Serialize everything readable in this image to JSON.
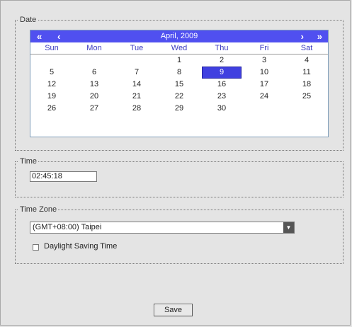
{
  "date_group": {
    "legend": "Date",
    "calendar": {
      "title": "April, 2009",
      "nav": {
        "prev_year": "«",
        "prev_month": "‹",
        "next_month": "›",
        "next_year": "»"
      },
      "weekdays": [
        "Sun",
        "Mon",
        "Tue",
        "Wed",
        "Thu",
        "Fri",
        "Sat"
      ],
      "weeks": [
        [
          "",
          "",
          "",
          "1",
          "2",
          "3",
          "4"
        ],
        [
          "5",
          "6",
          "7",
          "8",
          "9",
          "10",
          "11"
        ],
        [
          "12",
          "13",
          "14",
          "15",
          "16",
          "17",
          "18"
        ],
        [
          "19",
          "20",
          "21",
          "22",
          "23",
          "24",
          "25"
        ],
        [
          "26",
          "27",
          "28",
          "29",
          "30",
          "",
          ""
        ]
      ],
      "selected_day": "9"
    }
  },
  "time_group": {
    "legend": "Time",
    "value": "02:45:18"
  },
  "timezone_group": {
    "legend": "Time Zone",
    "selected": "(GMT+08:00) Taipei",
    "daylight_label": "Daylight Saving Time",
    "daylight_checked": false
  },
  "actions": {
    "save_label": "Save"
  },
  "colors": {
    "calendar_header": "#5050f0",
    "weekday_text": "#3b3bbf",
    "selection": "#4040e0"
  }
}
